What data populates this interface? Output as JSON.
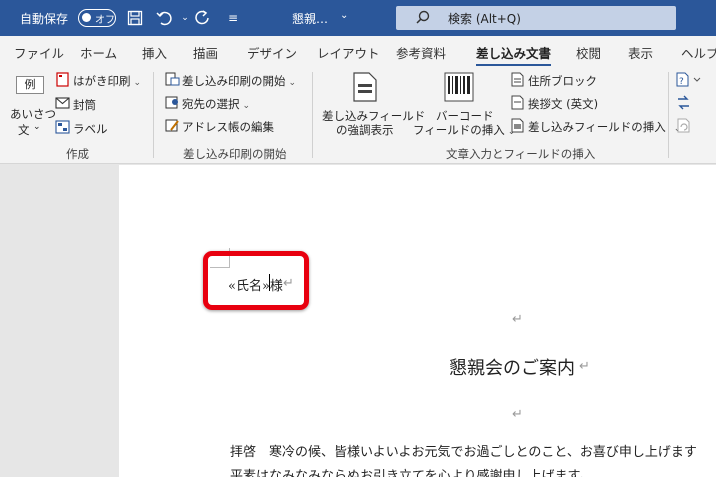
{
  "titlebar": {
    "autosave_label": "自動保存",
    "autosave_state": "オフ",
    "document_title": "懇親…",
    "search_text": "検索 (Alt+Q)"
  },
  "tabs": [
    "ファイル",
    "ホーム",
    "挿入",
    "描画",
    "デザイン",
    "レイアウト",
    "参考資料",
    "差し込み文書",
    "校閲",
    "表示",
    "ヘルプ"
  ],
  "active_tab": "差し込み文書",
  "ribbon": {
    "create": {
      "group_label": "作成",
      "greeting_line1": "あいさつ",
      "greeting_line2": "文",
      "example_icon_text": "例",
      "postcard": "はがき印刷",
      "envelope": "封筒",
      "label": "ラベル"
    },
    "start": {
      "group_label": "差し込み印刷の開始",
      "start_merge": "差し込み印刷の開始",
      "select_recipients": "宛先の選択",
      "edit_list": "アドレス帳の編集"
    },
    "insert": {
      "group_label": "文章入力とフィールドの挿入",
      "highlight_line1": "差し込みフィールド",
      "highlight_line2": "の強調表示",
      "barcode_line1": "バーコード",
      "barcode_line2": "フィールドの挿入",
      "address_block": "住所ブロック",
      "greeting_line": "挨拶文 (英文)",
      "insert_field": "差し込みフィールドの挿入"
    }
  },
  "document": {
    "merge_field": "«氏名»様",
    "para_mark": "↵",
    "heading": "懇親会のご案内",
    "line1": "拝啓　寒冷の候、皆様いよいよお元気でお過ごしとのこと、お喜び申し上げます",
    "line2": "平素はなみなみならぬお引き立てを心より感謝申し上げます。"
  }
}
